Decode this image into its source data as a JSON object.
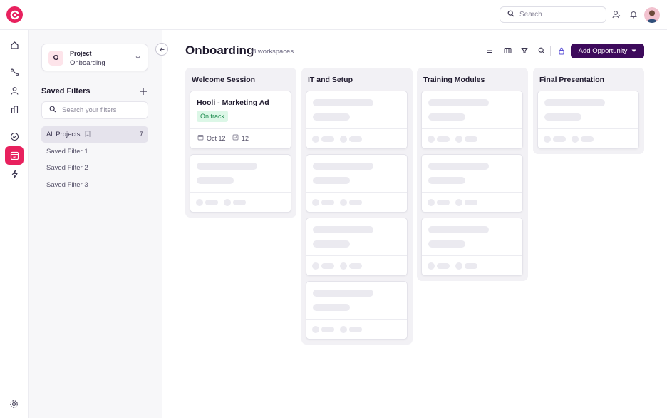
{
  "topbar": {
    "search_placeholder": "Search",
    "icons": [
      "logo-icon",
      "search-icon",
      "user-icon",
      "bell-icon",
      "avatar"
    ]
  },
  "rail": {
    "items": [
      "home-icon",
      "workflow-icon",
      "contacts-icon",
      "buildings-icon",
      "check-circle-icon",
      "board-icon",
      "lightning-icon",
      "settings-icon"
    ],
    "active": "board-icon"
  },
  "sidebar": {
    "project_label": "Project",
    "project_name": "Onboarding",
    "project_initial": "O",
    "saved_filters_title": "Saved Filters",
    "search_placeholder": "Search your filters",
    "items": [
      {
        "label": "All Projects",
        "count": "7",
        "active": true
      },
      {
        "label": "Saved Filter 1"
      },
      {
        "label": "Saved Filter 2"
      },
      {
        "label": "Saved Filter 3"
      }
    ]
  },
  "header": {
    "title": "Onboarding",
    "subtitle": "8 workspaces",
    "add_button": "Add Opportunity"
  },
  "board": {
    "columns": [
      {
        "title": "Welcome Session",
        "cards": 2
      },
      {
        "title": "IT and Setup",
        "cards": 4
      },
      {
        "title": "Training Modules",
        "cards": 3
      },
      {
        "title": "Final Presentation",
        "cards": 1
      }
    ],
    "featured_card": {
      "title": "Hooli - Marketing Ad",
      "status": "On track",
      "date": "Oct 12",
      "tasks": "12"
    }
  },
  "colors": {
    "brand": "#e8215e",
    "primary_button": "#3d0a5b",
    "status_green_bg": "#dcf7e7",
    "status_green_text": "#1d8a4d"
  }
}
